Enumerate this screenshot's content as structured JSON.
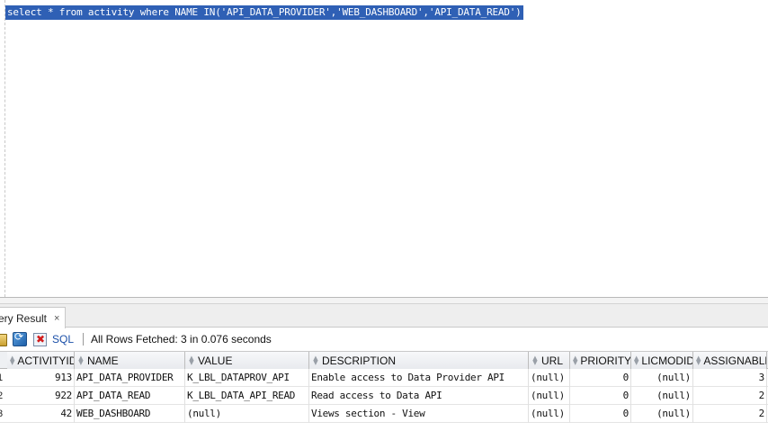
{
  "editor": {
    "sql": "select * from activity where NAME IN('API_DATA_PROVIDER','WEB_DASHBOARD','API_DATA_READ')"
  },
  "results": {
    "tab_label": "ery Result",
    "tab_close": "×",
    "toolbar": {
      "sql_label": "SQL",
      "status": "All Rows Fetched: 3 in 0.076 seconds"
    },
    "columns": [
      "ACTIVITYID",
      "NAME",
      "VALUE",
      "DESCRIPTION",
      "URL",
      "PRIORITY",
      "LICMODID",
      "ASSIGNABLE"
    ],
    "rows": [
      {
        "num": "1",
        "activityid": "913",
        "name": "API_DATA_PROVIDER",
        "value": "K_LBL_DATAPROV_API",
        "description": "Enable access to Data Provider API",
        "url": "(null)",
        "priority": "0",
        "licmodid": "(null)",
        "assignable": "3"
      },
      {
        "num": "2",
        "activityid": "922",
        "name": "API_DATA_READ",
        "value": "K_LBL_DATA_API_READ",
        "description": "Read access to Data API",
        "url": "(null)",
        "priority": "0",
        "licmodid": "(null)",
        "assignable": "2"
      },
      {
        "num": "3",
        "activityid": "42",
        "name": "WEB_DASHBOARD",
        "value": "(null)",
        "description": "Views section - View",
        "url": "(null)",
        "priority": "0",
        "licmodid": "(null)",
        "assignable": "2"
      }
    ]
  },
  "icons": {
    "pin": "pin-icon",
    "refresh": "refresh-icon",
    "cancel": "cancel-query-icon",
    "sort": "sort-icon"
  },
  "colors": {
    "selection": "#2f60b5",
    "link": "#1a4fa8"
  }
}
